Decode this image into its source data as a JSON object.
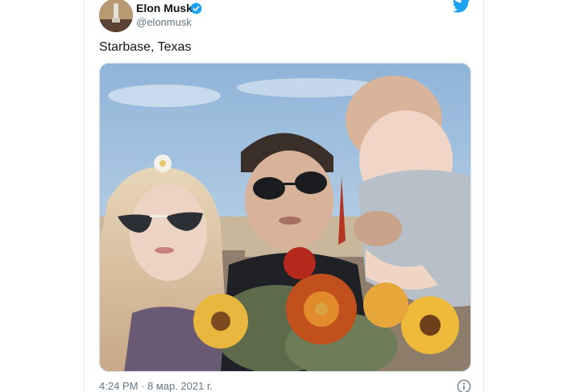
{
  "tweet": {
    "author": {
      "name": "Elon Musk",
      "handle": "@elonmusk",
      "verified": true,
      "avatar_icon": "avatar-photo"
    },
    "text": "Starbase, Texas",
    "media": {
      "type": "photo"
    },
    "timestamp": "4:24 PM · 8 мар. 2021 г.",
    "brand_icon": "twitter-bird-icon",
    "info_icon": "info-icon"
  },
  "colors": {
    "brand_blue": "#1da1f2",
    "text_primary": "#14171a",
    "text_secondary": "#657786",
    "border": "#e1e8ed"
  }
}
